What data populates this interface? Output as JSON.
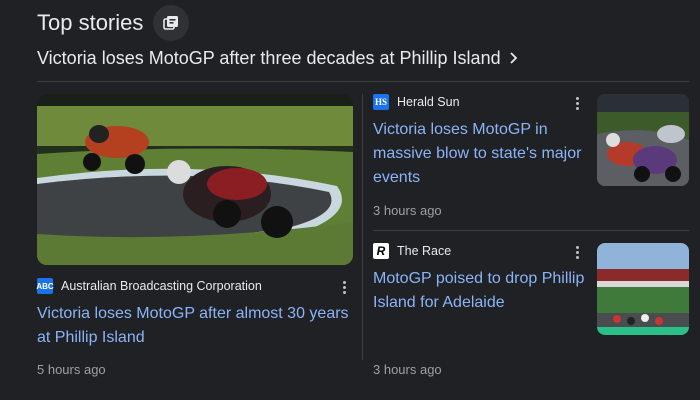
{
  "header": {
    "title": "Top stories"
  },
  "subhead": {
    "text": "Victoria loses MotoGP after three decades at Phillip Island"
  },
  "story_main": {
    "source": "Australian Broadcasting Corporation",
    "source_logo": "ABC",
    "headline": "Victoria loses MotoGP after almost 30 years at Phillip Island",
    "time": "5 hours ago"
  },
  "story_2": {
    "source": "Herald Sun",
    "source_logo": "HS",
    "headline": "Victoria loses MotoGP in massive blow to state's major events",
    "time": "3 hours ago"
  },
  "story_3": {
    "source": "The Race",
    "source_logo": "R",
    "headline": "MotoGP poised to drop Phillip Island for Adelaide",
    "time": "3 hours ago"
  },
  "icons": {
    "stack": "stacked-cards-icon",
    "chevron": "chevron-right-icon",
    "more": "more-vert-icon"
  },
  "colors": {
    "link": "#8ab4f8",
    "background": "#202124",
    "muted": "#9aa0a6"
  }
}
